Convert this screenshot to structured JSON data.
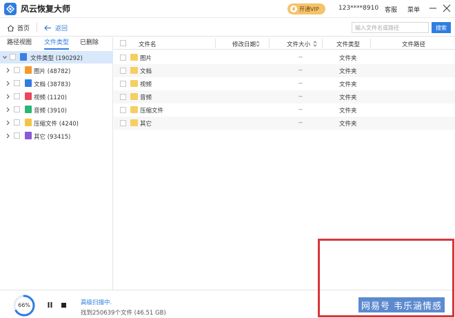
{
  "app": {
    "title": "风云恢复大师",
    "vip_label": "开通VIP",
    "phone": "123****8910",
    "service": "客服",
    "menu": "菜单"
  },
  "toolbar": {
    "home": "首页",
    "back": "返回",
    "search_placeholder": "输入文件名或路径",
    "search_button": "搜索"
  },
  "tabs": [
    "路径视图",
    "文件类型",
    "已删除"
  ],
  "tree": [
    {
      "label": "文件类型 (190292)",
      "icon": "drive-icon",
      "color": "#3b7fe0"
    },
    {
      "label": "图片 (48782)",
      "icon": "image-icon",
      "color": "#f39a2b"
    },
    {
      "label": "文档 (38783)",
      "icon": "doc-icon",
      "color": "#2f7de1"
    },
    {
      "label": "视频 (1120)",
      "icon": "video-icon",
      "color": "#e8485a"
    },
    {
      "label": "音频 (3910)",
      "icon": "audio-icon",
      "color": "#2bb673"
    },
    {
      "label": "压缩文件 (4240)",
      "icon": "archive-icon",
      "color": "#f6c343"
    },
    {
      "label": "其它 (93415)",
      "icon": "other-icon",
      "color": "#8a5bd6"
    }
  ],
  "table": {
    "columns": [
      "文件名",
      "修改日期",
      "文件大小",
      "文件类型",
      "文件路径"
    ],
    "rows": [
      {
        "name": "图片",
        "size": "--",
        "type": "文件夹"
      },
      {
        "name": "文档",
        "size": "--",
        "type": "文件夹"
      },
      {
        "name": "视频",
        "size": "--",
        "type": "文件夹"
      },
      {
        "name": "音频",
        "size": "--",
        "type": "文件夹"
      },
      {
        "name": "压缩文件",
        "size": "--",
        "type": "文件夹"
      },
      {
        "name": "其它",
        "size": "--",
        "type": "文件夹"
      }
    ]
  },
  "status": {
    "progress": 0.66,
    "progress_text": "66%",
    "scan_status": "高级扫描中.",
    "found_text": "找到250639个文件 (46.51 GB)"
  },
  "watermark": "网易号 韦乐涵情感",
  "colors": {
    "accent": "#2f7de1",
    "vip": "#f5c36b",
    "highlight": "#d9e8fa",
    "red_box": "#d8363b"
  }
}
